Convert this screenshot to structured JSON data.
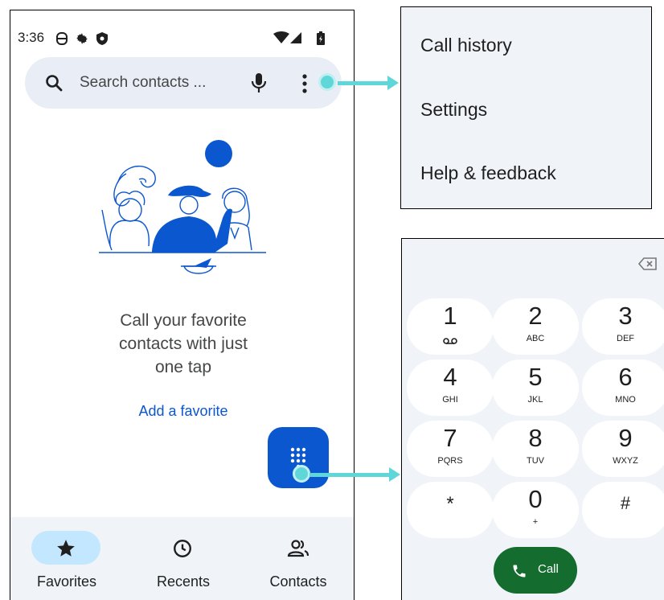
{
  "status_bar": {
    "time": "3:36"
  },
  "search": {
    "placeholder": "Search contacts ..."
  },
  "favorites_empty": {
    "line1": "Call your favorite",
    "line2": "contacts with just",
    "line3": "one tap",
    "add_favorite": "Add a favorite"
  },
  "bottom_nav": [
    {
      "label": "Favorites",
      "icon": "star-icon",
      "active": true
    },
    {
      "label": "Recents",
      "icon": "clock-icon",
      "active": false
    },
    {
      "label": "Contacts",
      "icon": "people-icon",
      "active": false
    }
  ],
  "overflow_menu": {
    "items": [
      "Call history",
      "Settings",
      "Help & feedback"
    ]
  },
  "dialpad": {
    "keys": [
      {
        "digit": "1",
        "letters": ""
      },
      {
        "digit": "2",
        "letters": "ABC"
      },
      {
        "digit": "3",
        "letters": "DEF"
      },
      {
        "digit": "4",
        "letters": "GHI"
      },
      {
        "digit": "5",
        "letters": "JKL"
      },
      {
        "digit": "6",
        "letters": "MNO"
      },
      {
        "digit": "7",
        "letters": "PQRS"
      },
      {
        "digit": "8",
        "letters": "TUV"
      },
      {
        "digit": "9",
        "letters": "WXYZ"
      },
      {
        "digit": "*",
        "letters": ""
      },
      {
        "digit": "0",
        "letters": "+"
      },
      {
        "digit": "#",
        "letters": ""
      }
    ],
    "call_label": "Call"
  },
  "colors": {
    "accent_blue": "#0b57d0",
    "call_green": "#146c2e",
    "arrow_teal": "#5fd6d8",
    "surface": "#f0f4f9",
    "nav_active": "#c2e7ff"
  }
}
